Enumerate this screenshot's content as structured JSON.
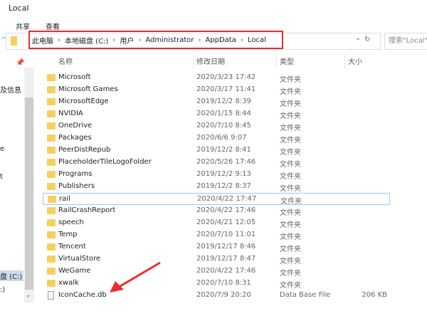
{
  "window": {
    "title": "Local"
  },
  "ribbon": {
    "tabs": [
      "共享",
      "查看"
    ]
  },
  "address": {
    "crumbs": [
      "此电脑",
      "本地磁盘 (C:)",
      "用户",
      "Administrator",
      "AppData",
      "Local"
    ],
    "refresh": "↻",
    "dropdown": "⌄"
  },
  "search": {
    "placeholder": "搜索\"Local\""
  },
  "nav": {
    "items": [
      "及信息",
      "e",
      "t",
      "盘 (C:)",
      ":)"
    ]
  },
  "columns": [
    "名称",
    "修改日期",
    "类型",
    "大小"
  ],
  "files": [
    {
      "name": "Microsoft",
      "date": "2020/3/23 17:42",
      "type": "文件夹",
      "size": "",
      "icon": "folder"
    },
    {
      "name": "Microsoft Games",
      "date": "2020/3/17 11:41",
      "type": "文件夹",
      "size": "",
      "icon": "folder"
    },
    {
      "name": "MicrosoftEdge",
      "date": "2019/12/2 8:39",
      "type": "文件夹",
      "size": "",
      "icon": "folder"
    },
    {
      "name": "NVIDIA",
      "date": "2020/1/15 8:44",
      "type": "文件夹",
      "size": "",
      "icon": "folder"
    },
    {
      "name": "OneDrive",
      "date": "2020/7/10 8:45",
      "type": "文件夹",
      "size": "",
      "icon": "folder"
    },
    {
      "name": "Packages",
      "date": "2020/6/6 9:07",
      "type": "文件夹",
      "size": "",
      "icon": "folder"
    },
    {
      "name": "PeerDistRepub",
      "date": "2019/12/2 8:41",
      "type": "文件夹",
      "size": "",
      "icon": "folder"
    },
    {
      "name": "PlaceholderTileLogoFolder",
      "date": "2020/5/26 17:46",
      "type": "文件夹",
      "size": "",
      "icon": "folder"
    },
    {
      "name": "Programs",
      "date": "2019/12/2 9:13",
      "type": "文件夹",
      "size": "",
      "icon": "folder"
    },
    {
      "name": "Publishers",
      "date": "2019/12/2 8:37",
      "type": "文件夹",
      "size": "",
      "icon": "folder"
    },
    {
      "name": "rail",
      "date": "2020/4/22 17:47",
      "type": "文件夹",
      "size": "",
      "icon": "folder",
      "selected": true
    },
    {
      "name": "RailCrashReport",
      "date": "2020/4/22 17:46",
      "type": "文件夹",
      "size": "",
      "icon": "folder"
    },
    {
      "name": "speech",
      "date": "2020/4/21 12:05",
      "type": "文件夹",
      "size": "",
      "icon": "folder"
    },
    {
      "name": "Temp",
      "date": "2020/7/10 11:01",
      "type": "文件夹",
      "size": "",
      "icon": "folder"
    },
    {
      "name": "Tencent",
      "date": "2019/12/17 8:46",
      "type": "文件夹",
      "size": "",
      "icon": "folder"
    },
    {
      "name": "VirtualStore",
      "date": "2019/12/17 8:47",
      "type": "文件夹",
      "size": "",
      "icon": "folder"
    },
    {
      "name": "WeGame",
      "date": "2020/4/22 17:46",
      "type": "文件夹",
      "size": "",
      "icon": "folder"
    },
    {
      "name": "xwalk",
      "date": "2020/7/10 8:31",
      "type": "文件夹",
      "size": "",
      "icon": "folder"
    },
    {
      "name": "IconCache.db",
      "date": "2020/7/9 20:20",
      "type": "Data Base File",
      "size": "206 KB",
      "icon": "file"
    }
  ],
  "annotation": {
    "color": "#e83030"
  }
}
